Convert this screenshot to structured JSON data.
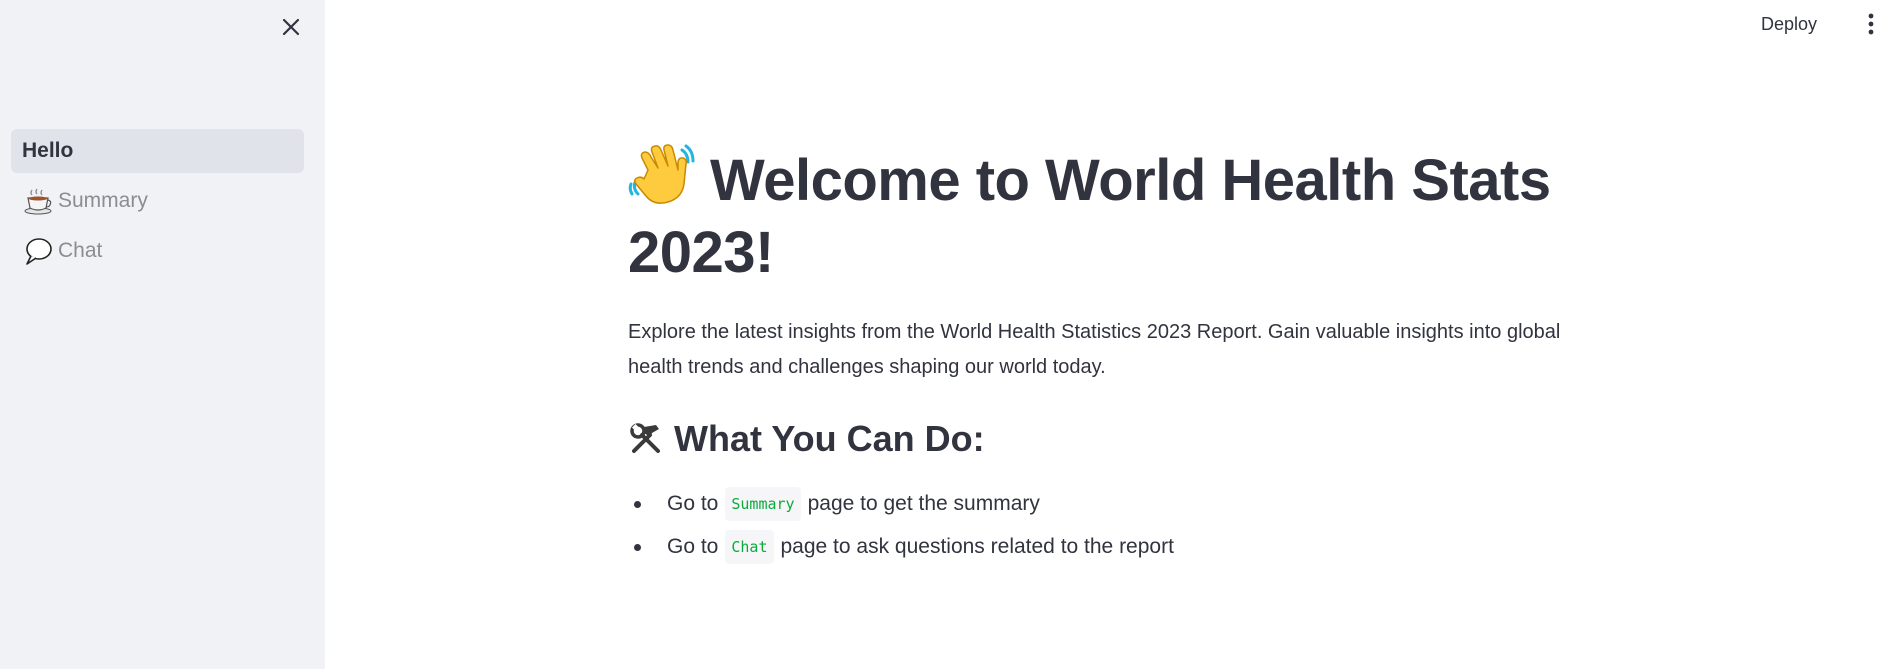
{
  "sidebar": {
    "close_icon": "close-icon",
    "items": [
      {
        "label": "Hello",
        "icon": ""
      },
      {
        "label": "Summary",
        "icon": "tea-cup-icon"
      },
      {
        "label": "Chat",
        "icon": "speech-bubble-icon"
      }
    ]
  },
  "topbar": {
    "deploy_label": "Deploy",
    "menu_icon": "vertical-dots-icon"
  },
  "main": {
    "title": "Welcome to World Health Stats 2023!",
    "title_icon": "waving-hand-icon",
    "intro": "Explore the latest insights from the World Health Statistics 2023 Report. Gain valuable insights into global health trends and challenges shaping our world today.",
    "subheading": "What You Can Do:",
    "subheading_icon": "hammer-wrench-icon",
    "list": [
      {
        "prefix": "Go to",
        "code": "Summary",
        "suffix": "page to get the summary"
      },
      {
        "prefix": "Go to",
        "code": "Chat",
        "suffix": "page to ask questions related to the report"
      }
    ]
  },
  "colors": {
    "sidebar_bg": "#f0f2f6",
    "active_item_bg": "#e0e4ea",
    "text": "#31333f",
    "muted_text": "#8c8d94",
    "code_green": "#09ab3b"
  }
}
